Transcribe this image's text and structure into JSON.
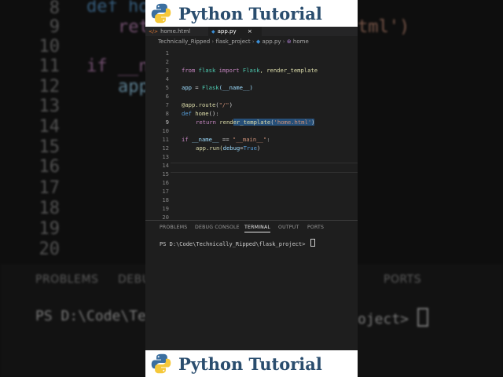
{
  "banner": {
    "title": "Python Tutorial"
  },
  "tabs": [
    {
      "label": "home.html",
      "icon": "html-file-icon"
    },
    {
      "label": "app.py",
      "icon": "python-file-icon",
      "close": "×"
    }
  ],
  "breadcrumb": [
    "Technically_Ripped",
    "flask_project",
    "app.py",
    "home"
  ],
  "editor": {
    "line_numbers": [
      "1",
      "2",
      "3",
      "4",
      "5",
      "6",
      "7",
      "8",
      "9",
      "10",
      "11",
      "12",
      "13",
      "14",
      "15",
      "16",
      "17",
      "18",
      "19",
      "20"
    ],
    "code": {
      "l3_kw1": "from",
      "l3_mod": " flask ",
      "l3_kw2": "import",
      "l3_cls": " Flask",
      "l3_rest": ", render_template",
      "l5_var": "app",
      "l5_eq": " = ",
      "l5_cls": "Flask",
      "l5_arg": "(__name__)",
      "l7_fn": "@app.route",
      "l7_p1": "(",
      "l7_str": "\"/\"",
      "l7_p2": ")",
      "l8_kw": "def",
      "l8_fn": " home",
      "l8_rest": "():",
      "l9_kw": "return",
      "l9_fn1": " rend",
      "l9_fn2": "er_template",
      "l9_p1": "(",
      "l9_str": "'home.html'",
      "l9_p2": ")",
      "l11_kw": "if",
      "l11_var": " __name__",
      "l11_eq": " == ",
      "l11_str": "\"__main__\"",
      "l11_col": ":",
      "l12_a": "app.run(",
      "l12_var": "debug",
      "l12_eq": "=",
      "l12_bl": "True",
      "l12_end": ")"
    }
  },
  "terminal": {
    "tabs": [
      "PROBLEMS",
      "DEBUG CONSOLE",
      "TERMINAL",
      "OUTPUT",
      "PORTS"
    ],
    "active_tab": "TERMINAL",
    "prompt": "PS D:\\Code\\Technically_Ripped\\flask_project> "
  },
  "background": {
    "line_numbers": [
      "8",
      "9",
      "10",
      "11",
      "12",
      "13",
      "14",
      "15",
      "16",
      "17",
      "18",
      "19",
      "20"
    ],
    "code_fragments": [
      "def home",
      "retu",
      "tml')",
      "if __nam",
      "app"
    ],
    "panel_tabs": [
      "PROBLEMS",
      "DEBU",
      "PORTS"
    ],
    "prompt_left": "PS D:\\Code\\Tec",
    "prompt_right": "oject>"
  },
  "colors": {
    "banner_title": "#2a4d6e",
    "editor_bg": "#1e1e1e",
    "keyword": "#c586c0",
    "string": "#ce9178",
    "function": "#dcdcaa"
  }
}
